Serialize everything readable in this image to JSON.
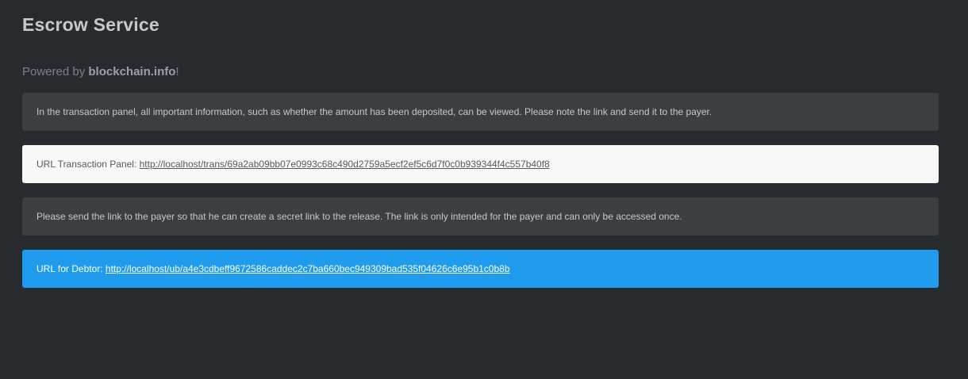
{
  "header": {
    "title": "Escrow Service",
    "powered_prefix": "Powered by ",
    "powered_brand": "blockchain.info",
    "powered_suffix": "!"
  },
  "info_transaction": {
    "text": "In the transaction panel, all important information, such as whether the amount has been deposited, can be viewed. Please note the link and send it to the payer."
  },
  "transaction_panel": {
    "label": "URL Transaction Panel: ",
    "url": "http://localhost/trans/69a2ab09bb07e0993c68c490d2759a5ecf2ef5c6d7f0c0b939344f4c557b40f8"
  },
  "info_payer": {
    "text": "Please send the link to the payer so that he can create a secret link to the release. The link is only intended for the payer and can only be accessed once."
  },
  "debtor_panel": {
    "label": "URL for Debtor: ",
    "url": "http://localhost/ub/a4e3cdbeff9672586caddec2c7ba660bec949309bad535f04626c6e95b1c0b8b"
  },
  "colors": {
    "background": "#272b30",
    "panel_dark": "#3a3f44",
    "panel_light": "#f8f8f8",
    "accent_blue": "#209cee"
  }
}
